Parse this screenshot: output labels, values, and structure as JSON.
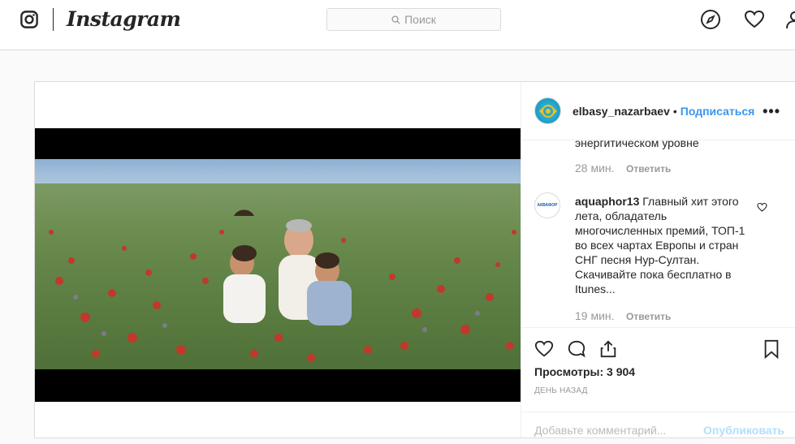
{
  "header": {
    "brand": "Instagram",
    "search_placeholder": "Поиск"
  },
  "post": {
    "username": "elbasy_nazarbaev",
    "separator": "•",
    "follow_label": "Подписаться",
    "more_label": "•••"
  },
  "comments": [
    {
      "partial_text": "энергитическом уровне",
      "time": "28 мин.",
      "reply_label": "Ответить"
    },
    {
      "username": "aquaphor13",
      "text": "Главный хит этого лета, обладатель многочисленных премий, ТОП-1 во всех чартах Европы и стран СНГ песня Нур-Султан. Скачивайте пока бесплатно в Itunes...",
      "time": "19 мин.",
      "reply_label": "Ответить",
      "avatar_text": "АКВАФОР"
    }
  ],
  "stats": {
    "views": "Просмотры: 3 904",
    "posted": "ДЕНЬ НАЗАД"
  },
  "add_comment": {
    "placeholder": "Добавьте комментарий...",
    "post_label": "Опубликовать"
  },
  "icons": [
    "instagram-camera-icon",
    "search-icon",
    "compass-icon",
    "heart-icon",
    "heart-outline-icon",
    "comment-icon",
    "share-icon",
    "bookmark-icon"
  ],
  "colors": {
    "accent": "#3897f0",
    "border": "#dbdbdb",
    "muted": "#999999"
  }
}
